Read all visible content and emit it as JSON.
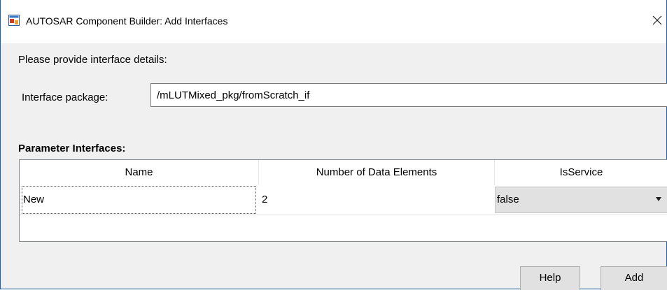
{
  "window": {
    "title": "AUTOSAR Component Builder: Add Interfaces",
    "close_label": "✕"
  },
  "form": {
    "prompt": "Please provide interface details:",
    "package_label": "Interface package:",
    "package_value": "/mLUTMixed_pkg/fromScratch_if"
  },
  "table": {
    "title": "Parameter Interfaces:",
    "columns": [
      "Name",
      "Number of Data Elements",
      "IsService"
    ],
    "rows": [
      {
        "name": "New",
        "data_elements": "2",
        "is_service": "false"
      }
    ]
  },
  "buttons": {
    "help": "Help",
    "add": "Add"
  },
  "icons": {
    "app": "matlab-dialog-icon",
    "close": "close-icon",
    "dropdown": "chevron-down-icon"
  }
}
